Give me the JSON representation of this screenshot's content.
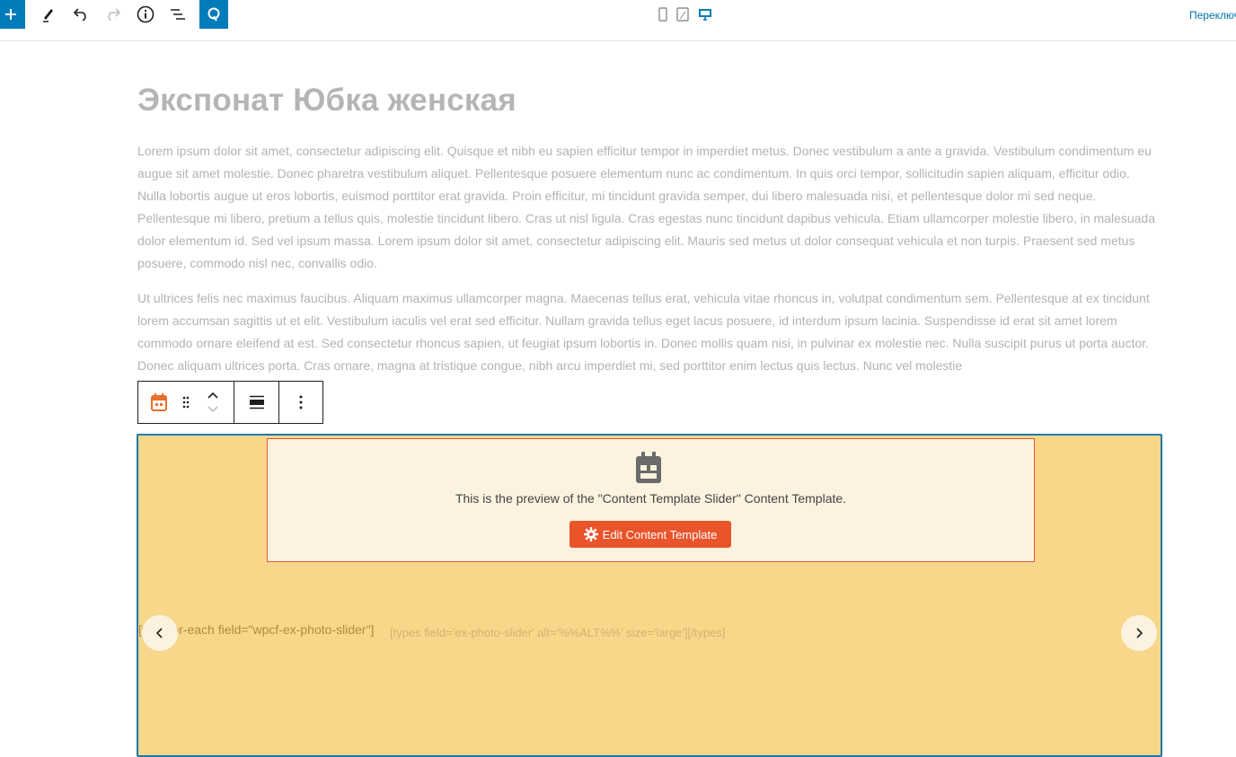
{
  "toolbar": {
    "icons": [
      "plus-icon",
      "pencil-icon",
      "undo-icon",
      "redo-icon",
      "info-icon",
      "list-view-icon",
      "toolset-icon"
    ],
    "devices": [
      "mobile-icon",
      "tablet-icon",
      "desktop-icon"
    ],
    "switch_link": "Переключиться",
    "accent": "#007cba"
  },
  "post": {
    "title": "Экспонат Юбка женская",
    "paragraphs": [
      "Lorem ipsum dolor sit amet, consectetur adipiscing elit. Quisque et nibh eu sapien efficitur tempor in imperdiet metus. Donec vestibulum a ante a gravida. Vestibulum condimentum eu augue sit amet molestie. Donec pharetra vestibulum aliquet. Pellentesque posuere elementum nunc ac condimentum. In quis orci tempor, sollicitudin sapien aliquam, efficitur odio. Nulla lobortis augue ut eros lobortis, euismod porttitor erat gravida. Proin efficitur, mi tincidunt gravida semper, dui libero malesuada nisi, et pellentesque dolor mi sed neque. Pellentesque mi libero, pretium a tellus quis, molestie tincidunt libero. Cras ut nisl ligula. Cras egestas nunc tincidunt dapibus vehicula. Etiam ullamcorper molestie libero, in malesuada dolor elementum id. Sed vel ipsum massa. Lorem ipsum dolor sit amet, consectetur adipiscing elit. Mauris sed metus ut dolor consequat vehicula et non turpis. Praesent sed metus posuere, commodo nisl nec, convallis odio.",
      "Ut ultrices felis nec maximus faucibus. Aliquam maximus ullamcorper magna. Maecenas tellus erat, vehicula vitae rhoncus in, volutpat condimentum sem. Pellentesque at ex tincidunt lorem accumsan sagittis ut et elit. Vestibulum iaculis vel erat sed efficitur. Nullam gravida tellus eget lacus posuere, id interdum ipsum lacinia. Suspendisse id erat sit amet lorem commodo ornare eleifend at est. Sed consectetur rhoncus sapien, ut feugiat ipsum lobortis in. Donec mollis quam nisi, in pulvinar ex molestie nec. Nulla suscipit purus ut porta auctor. Donec aliquam ultrices porta. Cras ornare, magna at tristique congue, nibh arcu imperdiet mi, sed porttitor enim lectus quis lectus. Nunc vel molestie"
    ]
  },
  "block_toolbar": {
    "icons": [
      "calendar-block-icon",
      "drag-handle-icon",
      "move-up-icon",
      "move-down-icon",
      "align-icon",
      "more-options-icon"
    ],
    "accent": "#e86f2c"
  },
  "slider": {
    "preview_text": "This is the preview of the \"Content Template Slider\" Content Template.",
    "edit_button": "Edit Content Template",
    "shortcode_1": "[wpv-for-each field=\"wpcf-ex-photo-slider\"]",
    "shortcode_2": "[types field='ex-photo-slider' alt='%%ALT%%' size='large'][/types]",
    "background": "#f8d78b",
    "border": "#1c7aa7",
    "button_color": "#e9542b"
  }
}
